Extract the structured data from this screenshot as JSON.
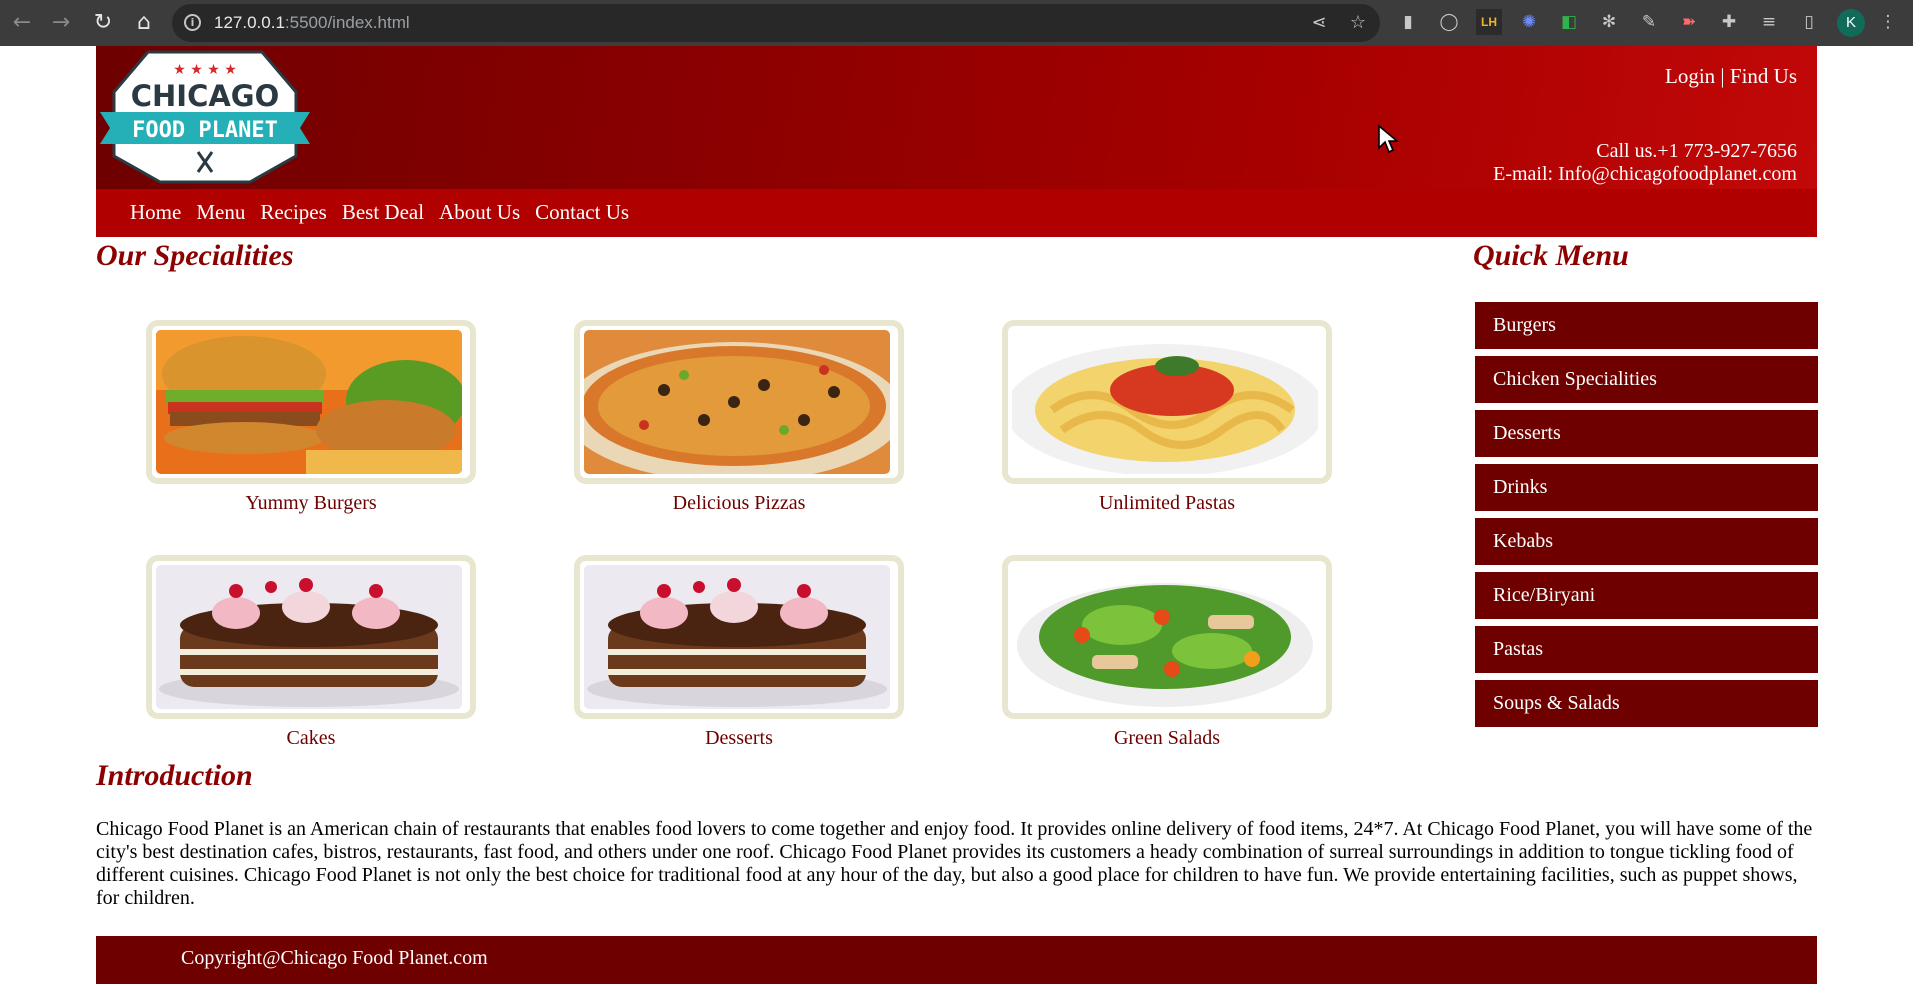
{
  "browser": {
    "url_host": "127.0.0.1",
    "url_port_path": ":5500/index.html",
    "profile_initial": "K",
    "extension_label": "LH"
  },
  "header": {
    "logo": {
      "stars": "★ ★ ★ ★",
      "line1": "CHICAGO",
      "line2": "FOOD PLANET"
    },
    "login_label": "Login",
    "separator": "|",
    "find_us_label": "Find Us",
    "phone": "Call us.+1 773-927-7656",
    "email": "E-mail: Info@chicagofoodplanet.com"
  },
  "nav": {
    "items": [
      "Home",
      "Menu",
      "Recipes",
      "Best Deal",
      "About Us",
      "Contact Us"
    ]
  },
  "specialities": {
    "title": "Our Specialities",
    "items": [
      {
        "caption": "Yummy Burgers",
        "image": "burger-image"
      },
      {
        "caption": "Delicious Pizzas",
        "image": "pizza-image"
      },
      {
        "caption": "Unlimited Pastas",
        "image": "pasta-image"
      },
      {
        "caption": "Cakes",
        "image": "cake-image"
      },
      {
        "caption": "Desserts",
        "image": "cake-image"
      },
      {
        "caption": "Green Salads",
        "image": "salad-image"
      }
    ]
  },
  "quick_menu": {
    "title": "Quick Menu",
    "items": [
      "Burgers",
      "Chicken Specialities",
      "Desserts",
      "Drinks",
      "Kebabs",
      "Rice/Biryani",
      "Pastas",
      "Soups & Salads"
    ]
  },
  "introduction": {
    "title": "Introduction",
    "text": "Chicago Food Planet is an American chain of restaurants that enables food lovers to come together and enjoy food. It provides online delivery of food items, 24*7. At Chicago Food Planet, you will have some of the city's best destination cafes, bistros, restaurants, fast food, and others under one roof. Chicago Food Planet provides its customers a heady combination of surreal surroundings in addition to tongue tickling food of different cuisines. Chicago Food Planet is not only the best choice for traditional food at any hour of the day, but also a good place for children to have fun. We provide entertaining facilities, such as puppet shows, for children."
  },
  "footer": {
    "copyright": "Copyright@Chicago Food Planet.com"
  },
  "colors": {
    "header_dark": "#6e0000",
    "header_bright": "#c20808",
    "navbar": "#b10000",
    "heading": "#8c0000",
    "caption": "#6e0000",
    "quick_menu_item": "#6e0000",
    "frame_border": "#e8e6cf"
  }
}
